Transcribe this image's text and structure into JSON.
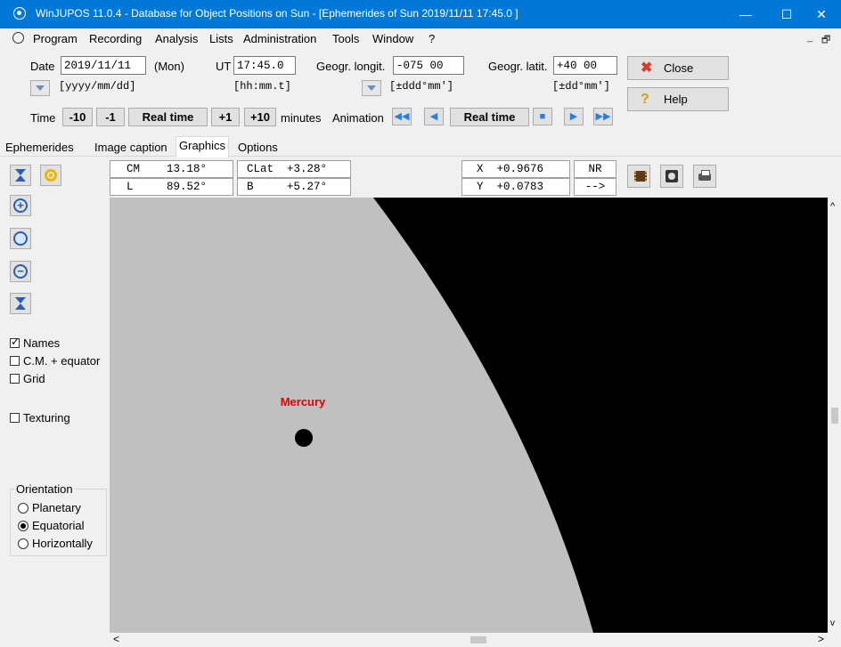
{
  "window": {
    "title": "WinJUPOS 11.0.4 - Database for Object Positions on Sun - [Ephemerides of Sun  2019/11/11  17:45.0 ]",
    "minimize": "—",
    "maximize": "☐",
    "close": "✕"
  },
  "menu": {
    "items": [
      "Program",
      "Recording",
      "Analysis",
      "Lists",
      "Administration",
      "Tools",
      "Window",
      "?"
    ],
    "mdi_min": "_",
    "mdi_restore": "🗗"
  },
  "form": {
    "date_label": "Date",
    "date_value": "2019/11/11",
    "date_day": "(Mon)",
    "date_hint": "[yyyy/mm/dd]",
    "ut_label": "UT",
    "ut_value": "17:45.0",
    "ut_hint": "[hh:mm.t]",
    "longit_label": "Geogr. longit.",
    "longit_value": "-075 00",
    "longit_hint": "[±ddd°mm']",
    "latit_label": "Geogr. latit.",
    "latit_value": "+40 00",
    "latit_hint": "[±dd°mm']",
    "close_label": "Close",
    "help_label": "Help"
  },
  "time_row": {
    "time_label": "Time",
    "minus10": "-10",
    "minus1": "-1",
    "realtime": "Real time",
    "plus1": "+1",
    "plus10": "+10",
    "minutes_label": "minutes",
    "animation_label": "Animation",
    "anim_realtime": "Real time"
  },
  "tabs": [
    "Ephemerides",
    "Image caption",
    "Graphics",
    "Options"
  ],
  "active_tab": "Graphics",
  "info": {
    "cm": "CM    13.18°",
    "l": "L     89.52°",
    "clat": "CLat  +3.28°",
    "b": "B     +5.27°",
    "x": "X  +0.9676",
    "y": "Y  +0.0783",
    "nr": "NR",
    "arrow": "-->"
  },
  "options": {
    "names": "Names",
    "cm_equator": "C.M. + equator",
    "grid": "Grid",
    "texturing": "Texturing",
    "names_checked": true,
    "cm_equator_checked": false,
    "grid_checked": false,
    "texturing_checked": false
  },
  "orientation": {
    "title": "Orientation",
    "planetary": "Planetary",
    "equatorial": "Equatorial",
    "horizontally": "Horizontally",
    "selected": "Equatorial"
  },
  "graphics": {
    "object_label": "Mercury",
    "label_color": "#e00000",
    "disk_color": "#c0c0c0",
    "sky_color": "#000000"
  },
  "scroll": {
    "up": "^",
    "down": "v",
    "left": "<",
    "right": ">"
  }
}
